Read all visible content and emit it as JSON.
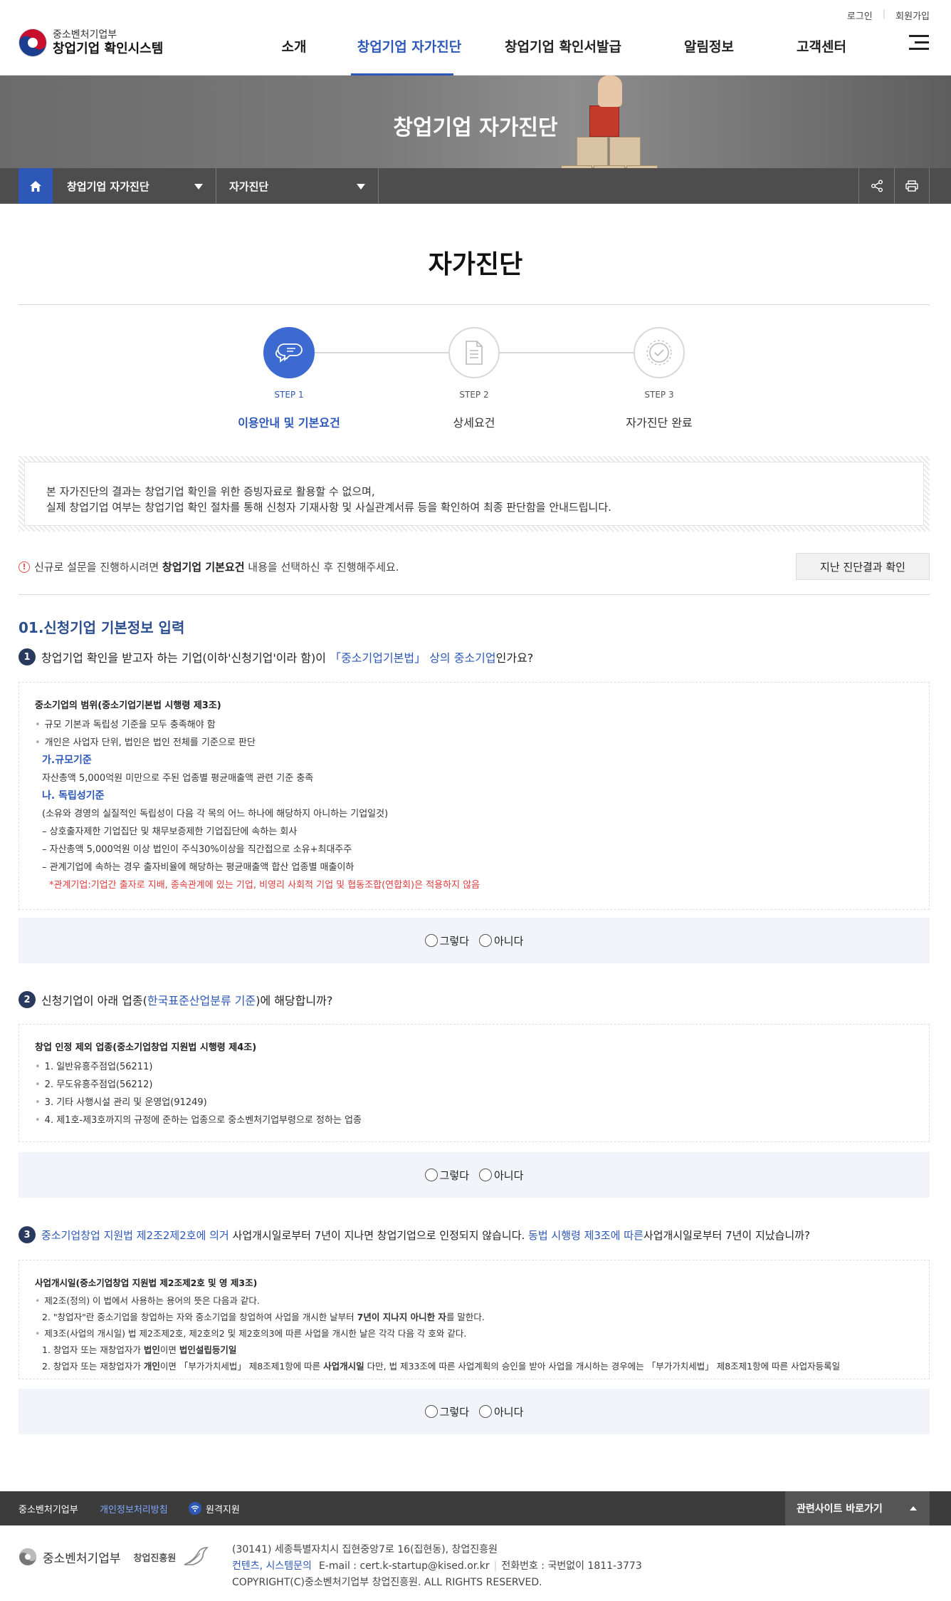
{
  "header": {
    "login": "로그인",
    "signup": "회원가입",
    "logo_line1": "중소벤처기업부",
    "logo_line2": "창업기업 확인시스템",
    "nav": [
      "소개",
      "창업기업 자가진단",
      "창업기업 확인서발급",
      "알림정보",
      "고객센터"
    ]
  },
  "banner": {
    "title": "창업기업 자가진단",
    "loc1": "창업기업 자가진단",
    "loc2": "자가진단"
  },
  "page_title": "자가진단",
  "steps": [
    {
      "num": "STEP 1",
      "label": "이용안내 및 기본요건"
    },
    {
      "num": "STEP 2",
      "label": "상세요건"
    },
    {
      "num": "STEP 3",
      "label": "자가진단 완료"
    }
  ],
  "notice": {
    "line1": "본 자가진단의 결과는 창업기업 확인을 위한 증빙자료로 활용할 수 없으며,",
    "line2": "실제 창업기업 여부는 창업기업 확인 절차를 통해 신청자 기재사항 및 사실관계서류 등을 확인하여 최종 판단함을 안내드립니다."
  },
  "alert": {
    "pre": "신규로 설문을 진행하시려면 ",
    "bold": "창업기업 기본요건",
    "post": " 내용을 선택하신 후 진행해주세요."
  },
  "past_button": "지난 진단결과 확인",
  "section_title": "01.신청기업 기본정보 입력",
  "radio": {
    "yes": "그렇다",
    "no": "아니다"
  },
  "q1": {
    "num": "1",
    "pre": "창업기업 확인을 받고자 하는 기업(이하'신청기업'이라 함)이 ",
    "hl": "「중소기업기본법」 상의 중소기업",
    "post": "인가요?",
    "box_title": "중소기업의 범위(중소기업기본법 시행령 제3조)",
    "bullets": [
      "규모 기본과 독립성 기준을 모두 충족해야 함",
      "개인은 사업자 단위, 법인은 법인 전체를 기준으로 판단"
    ],
    "sub_a": "가.규모기준",
    "sub_a_text": "자산총액 5,000억원 미만으로 주된 업종별 평균매출액 관련 기준 충족",
    "sub_b": "나. 독립성기준",
    "sub_b_lines": [
      "(소유와 경영의 실질적인 독립성이 다음 각 목의 어느 하나에 해당하지 아니하는 기업일것)",
      "– 상호출자제한 기업집단 및 채무보증제한 기업집단에 속하는 회사",
      "– 자산총액 5,000억원 이상 법인이 주식30%이상을 직간접으로 소유+최대주주",
      "– 관계기업에 속하는 경우 출자비율에 해당하는 평균매출액 합산 업종별 매출이하"
    ],
    "red_note": "*관계기업:기업간 출자로 지배, 종속관계에 있는 기업, 비영리 사회적 기업 및 협동조합(연합회)은 적용하지 않음"
  },
  "q2": {
    "num": "2",
    "pre": "신청기업이 아래 업종(",
    "hl": "한국표준산업분류 기준",
    "post": ")에 해당합니까?",
    "box_title": "창업 인정 제외 업종(중소기업창업 지원법 시행령 제4조)",
    "items": [
      "1. 일반유흥주점업(56211)",
      "2. 무도유흥주점업(56212)",
      "3. 기타 사행시설 관리 및 운영업(91249)",
      "4. 제1호-제3호까지의 규정에 준하는 업종으로 중소벤처기업부령으로 정하는 업종"
    ]
  },
  "q3": {
    "num": "3",
    "hl1": "중소기업창업 지원법 제2조2제2호에 의거",
    "mid": " 사업개시일로부터 7년이 지나면 창업기업으로 인정되지 않습니다. ",
    "hl2": "동법 시행령 제3조에 따른",
    "post": "사업개시일로부터 7년이 지났습니까?",
    "box_title": "사업개시일(중소기업창업 지원법 제2조제2호 및 영 제3조)",
    "b1": "제2조(정의) 이 법에서 사용하는 용어의 뜻은 다음과 같다.",
    "b1_2_pre": "2. \"창업자\"란 중소기업을 창업하는 자와 중소기업을 창업하여 사업을 개시한 날부터 ",
    "b1_2_bold": "7년이 지나지 아니한 자",
    "b1_2_post": "를 말한다.",
    "b2": "제3조(사업의 개시일) 법 제2조제2호, 제2호의2 및 제2호의3에 따른 사업을 개시한 날은 각각 다음 각 호와 같다.",
    "b2_1_pre": "1. 창업자 또는 재창업자가 ",
    "b2_1_bold1": "법인",
    "b2_1_mid": "이면 ",
    "b2_1_bold2": "법인설립등기일",
    "b2_2_pre": "2. 창업자 또는 재창업자가 ",
    "b2_2_bold1": "개인",
    "b2_2_mid": "이면 「부가가치세법」 제8조제1항에 따른 ",
    "b2_2_bold2": "사업개시일",
    "b2_2_post": " 다만, 법 제33조에 따른 사업계획의 승인을 받아 사업을 개시하는 경우에는 「부가가치세법」 제8조제1항에 따른 사업자등록일"
  },
  "footer": {
    "links": [
      "중소벤처기업부",
      "개인정보처리방침",
      "원격지원"
    ],
    "related": "관련사이트 바로가기",
    "logo1": "중소벤처기업부",
    "logo2": "창업진흥원",
    "addr": "(30141) 세종특별자치시 집현중앙7로 16(집현동), 창업진흥원",
    "contact_links": "컨텐츠, 시스템문의",
    "email": "E-mail : cert.k-startup@kised.or.kr",
    "phone": "전화번호 : 국번없이 1811-3773",
    "copyright": "COPYRIGHT(C)중소벤처기업부 창업진흥원. ALL RIGHTS RESERVED."
  },
  "colors": {
    "accent": "#2d58b8",
    "footer_bg": "#3c3c3c",
    "red_note": "#e03a3a"
  }
}
